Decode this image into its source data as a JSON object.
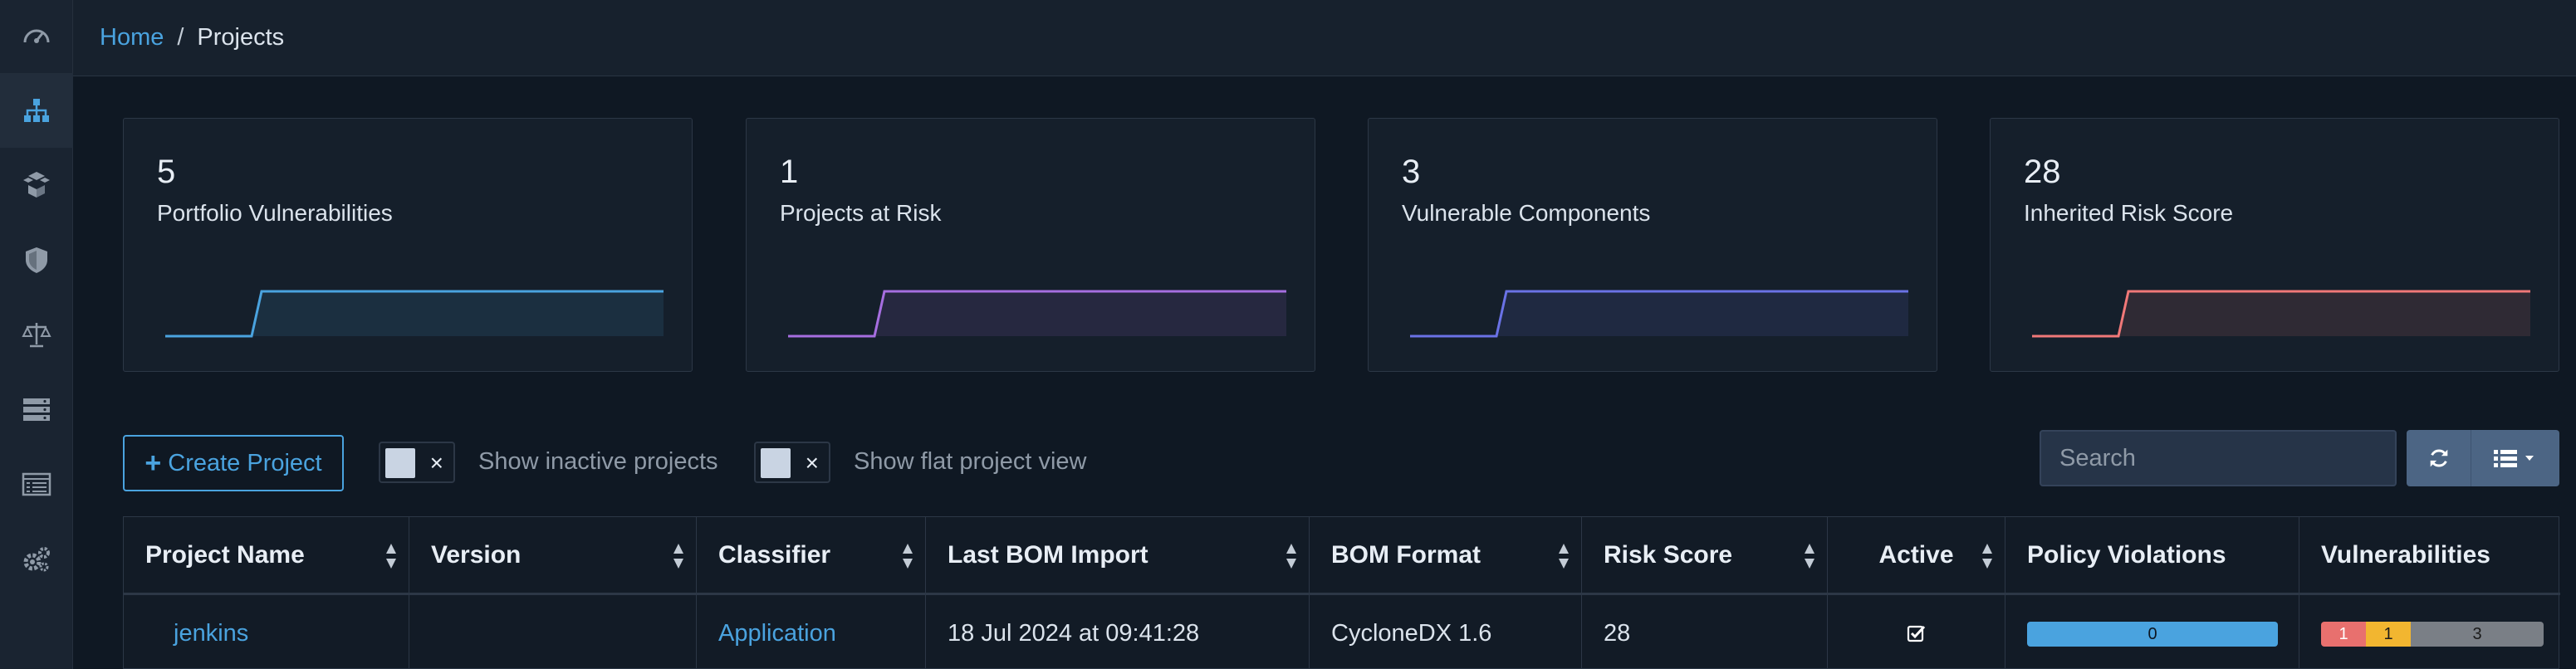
{
  "breadcrumb": {
    "home": "Home",
    "separator": "/",
    "current": "Projects"
  },
  "sidebar": {
    "items": [
      {
        "icon": "dashboard-icon",
        "active": false
      },
      {
        "icon": "projects-icon",
        "active": true
      },
      {
        "icon": "components-icon",
        "active": false
      },
      {
        "icon": "vulnerabilities-icon",
        "active": false
      },
      {
        "icon": "licenses-icon",
        "active": false
      },
      {
        "icon": "policy-icon",
        "active": false
      },
      {
        "icon": "audit-icon",
        "active": false
      },
      {
        "icon": "settings-icon",
        "active": false
      }
    ]
  },
  "cards": [
    {
      "value": "5",
      "label": "Portfolio Vulnerabilities",
      "color": "#4aa3df",
      "trend": [
        0,
        0,
        1,
        1
      ]
    },
    {
      "value": "1",
      "label": "Projects at Risk",
      "color": "#a66ee0",
      "trend": [
        0,
        0,
        1,
        1
      ]
    },
    {
      "value": "3",
      "label": "Vulnerable Components",
      "color": "#6a72e6",
      "trend": [
        0,
        0,
        1,
        1
      ]
    },
    {
      "value": "28",
      "label": "Inherited Risk Score",
      "color": "#f07878",
      "trend": [
        0,
        0,
        1,
        1
      ]
    }
  ],
  "toolbar": {
    "create_project": "Create Project",
    "show_inactive": "Show inactive projects",
    "show_flat": "Show flat project view",
    "toggle_x": "×",
    "search_placeholder": "Search"
  },
  "table": {
    "columns": [
      "Project Name",
      "Version",
      "Classifier",
      "Last BOM Import",
      "BOM Format",
      "Risk Score",
      "Active",
      "Policy Violations",
      "Vulnerabilities"
    ],
    "rows": [
      {
        "project_name": "jenkins",
        "version": "",
        "classifier": "Application",
        "last_bom_import": "18 Jul 2024 at 09:41:28",
        "bom_format": "CycloneDX 1.6",
        "risk_score": "28",
        "active": true,
        "policy_violations": "0",
        "vulnerabilities": {
          "critical": "1",
          "high": "1",
          "unassigned": "3"
        }
      }
    ]
  },
  "colors": {
    "accent": "#4aa3df",
    "critical": "#e8706e",
    "high": "#f2b630",
    "unassigned": "#7a7f86"
  }
}
